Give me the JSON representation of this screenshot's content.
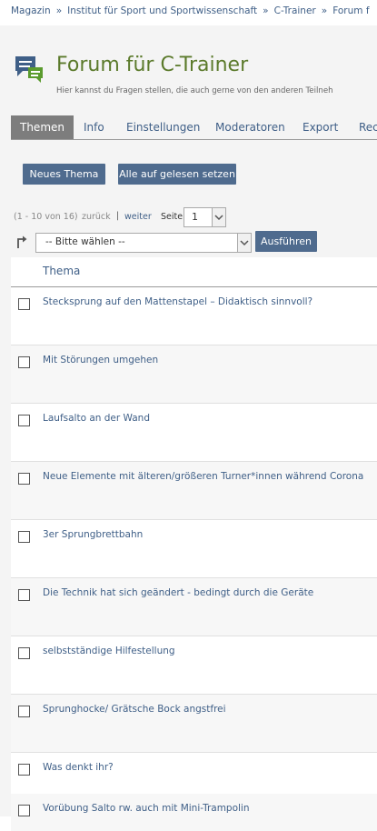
{
  "breadcrumb": [
    "Magazin",
    "Institut für Sport und Sportwissenschaft",
    "C-Trainer",
    "Forum f"
  ],
  "forum": {
    "title": "Forum für C-Trainer",
    "description": "Hier kannst du Fragen stellen, die auch gerne von den anderen Teilneh"
  },
  "tabs": [
    "Themen",
    "Info",
    "Einstellungen",
    "Moderatoren",
    "Export",
    "Rech"
  ],
  "buttons": {
    "new_topic": "Neues Thema",
    "mark_all_read": "Alle auf gelesen setzen",
    "execute": "Ausführen"
  },
  "pager": {
    "count": "(1 - 10 von 16)",
    "back": "zurück",
    "separator": "|",
    "next": "weiter",
    "page_label": "Seite",
    "page_value": "1"
  },
  "action_select": {
    "value": "-- Bitte wählen --"
  },
  "table": {
    "header": "Thema",
    "rows": [
      "Stecksprung auf den Mattenstapel – Didaktisch sinnvoll?",
      "Mit Störungen umgehen",
      "Laufsalto an der Wand",
      "Neue Elemente mit älteren/größeren Turner*innen während Corona",
      "3er Sprungbrettbahn",
      "Die Technik hat sich geändert - bedingt durch die Geräte",
      "selbstständige Hilfestellung",
      "Sprunghocke/ Grätsche Bock angstfrei",
      "Was denkt ihr?",
      "Vorübung Salto rw. auch mit Mini-Trampolin"
    ]
  },
  "colors": {
    "link": "#3f5f87",
    "title_green": "#5b7a2b",
    "button_bg": "#4f6b8e",
    "active_tab": "#7d7d7d"
  },
  "icons": {
    "forum": "forum-chat-icon",
    "action": "turn-arrow-icon",
    "dropdown": "chevron-down-icon"
  }
}
